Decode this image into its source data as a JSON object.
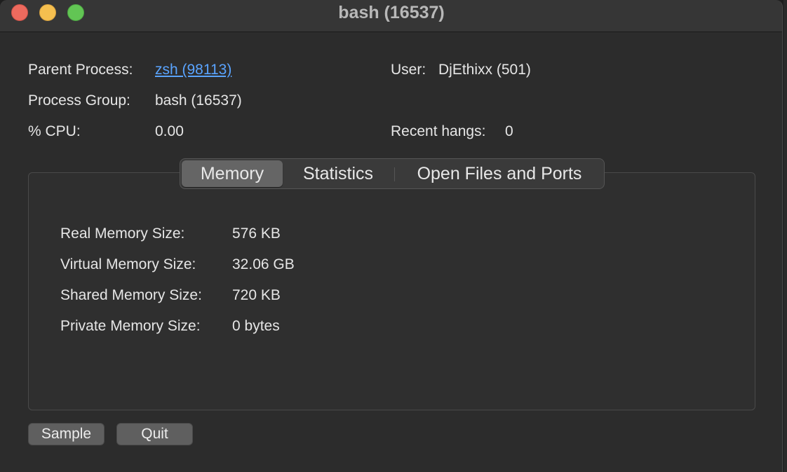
{
  "window": {
    "title": "bash (16537)"
  },
  "info": {
    "parent_process_label": "Parent Process:",
    "parent_process_value": "zsh (98113)",
    "user_label": "User:",
    "user_value": "DjEthixx (501)",
    "process_group_label": "Process Group:",
    "process_group_value": "bash (16537)",
    "cpu_label": "% CPU:",
    "cpu_value": "0.00",
    "recent_hangs_label": "Recent hangs:",
    "recent_hangs_value": "0"
  },
  "tabs": [
    {
      "label": "Memory",
      "selected": true
    },
    {
      "label": "Statistics",
      "selected": false
    },
    {
      "label": "Open Files and Ports",
      "selected": false
    }
  ],
  "memory": [
    {
      "label": "Real Memory Size:",
      "value": "576 KB"
    },
    {
      "label": "Virtual Memory Size:",
      "value": "32.06 GB"
    },
    {
      "label": "Shared Memory Size:",
      "value": "720 KB"
    },
    {
      "label": "Private Memory Size:",
      "value": "0 bytes"
    }
  ],
  "buttons": {
    "sample": "Sample",
    "quit": "Quit"
  },
  "colors": {
    "link": "#5aa4ff",
    "close": "#ed6a5e",
    "minimize": "#f5bf4f",
    "zoom": "#62c554"
  }
}
